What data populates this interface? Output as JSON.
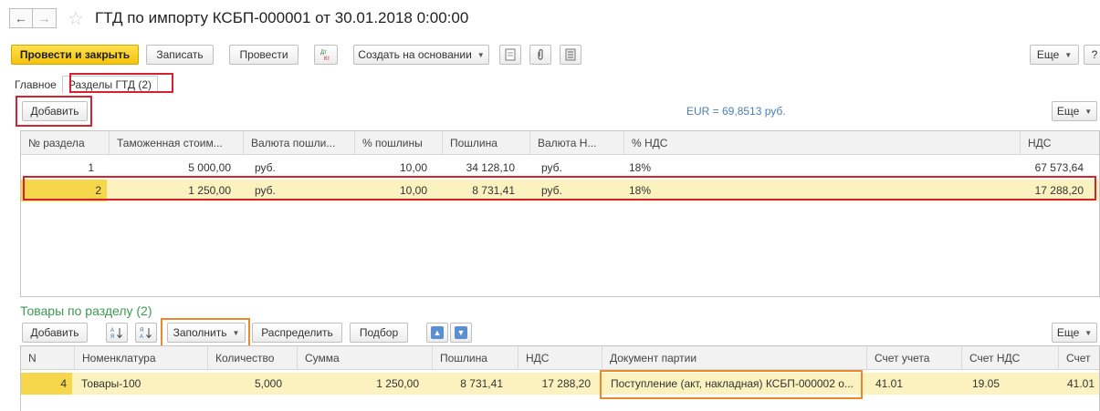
{
  "window": {
    "title": "ГТД по импорту КСБП-000001 от 30.01.2018 0:00:00",
    "back_glyph": "←",
    "forward_glyph": "→",
    "star_glyph": "☆"
  },
  "toolbar": {
    "post_close": "Провести и закрыть",
    "save": "Записать",
    "post": "Провести",
    "dt_kt_glyph": "Дт Кт",
    "create_based": "Создать на основании",
    "more": "Еще",
    "help": "?"
  },
  "tabs": [
    {
      "label": "Главное"
    },
    {
      "label": "Разделы ГТД (2)"
    }
  ],
  "sections": {
    "add_button": "Добавить",
    "rate": "EUR = 69,8513 руб.",
    "more": "Еще",
    "columns": [
      "№ раздела",
      "Таможенная стоим...",
      "Валюта пошли...",
      "% пошлины",
      "Пошлина",
      "Валюта Н...",
      "% НДС",
      "НДС"
    ],
    "rows": [
      {
        "num": "1",
        "customs_value": "5 000,00",
        "duty_currency": "руб.",
        "duty_pct": "10,00",
        "duty": "34 128,10",
        "vat_currency": "руб.",
        "vat_pct": "18%",
        "vat": "67 573,64"
      },
      {
        "num": "2",
        "customs_value": "1 250,00",
        "duty_currency": "руб.",
        "duty_pct": "10,00",
        "duty": "8 731,41",
        "vat_currency": "руб.",
        "vat_pct": "18%",
        "vat": "17 288,20"
      }
    ]
  },
  "goods": {
    "title": "Товары по разделу (2)",
    "add_button": "Добавить",
    "fill_button": "Заполнить",
    "distribute_button": "Распределить",
    "select_button": "Подбор",
    "more": "Еще",
    "columns": [
      "N",
      "Номенклатура",
      "Количество",
      "Сумма",
      "Пошлина",
      "НДС",
      "Документ партии",
      "Счет учета",
      "Счет НДС",
      "Счет"
    ],
    "rows": [
      {
        "n": "4",
        "item": "Товары-100",
        "qty": "5,000",
        "sum": "1 250,00",
        "duty": "8 731,41",
        "vat": "17 288,20",
        "doc": "Поступление (акт, накладная) КСБП-000002 о...",
        "account": "41.01",
        "vat_account": "19.05",
        "account2": "41.01"
      }
    ]
  },
  "colors": {
    "accent_yellow": "#f4c30c",
    "selection_row": "#fbf2bf",
    "highlight_red": "#d4232f",
    "highlight_orange": "#e8892c",
    "section_title_green": "#3c9a50",
    "rate_blue": "#4a7fb5"
  }
}
